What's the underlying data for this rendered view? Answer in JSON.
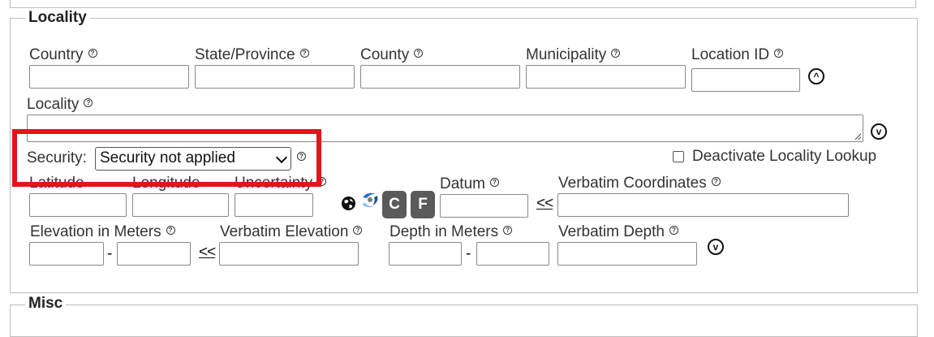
{
  "sections": {
    "locality_legend": "Locality",
    "misc_legend": "Misc"
  },
  "row1": {
    "country_label": "Country",
    "state_label": "State/Province",
    "county_label": "County",
    "municipality_label": "Municipality",
    "location_id_label": "Location ID"
  },
  "locality_label": "Locality",
  "security": {
    "label": "Security:",
    "selected": "Security not applied"
  },
  "deactivate_label": "Deactivate Locality Lookup",
  "row3": {
    "latitude_label": "Latitude",
    "longitude_label": "Longitude",
    "uncertainty_label": "Uncertainty",
    "datum_label": "Datum",
    "verbatim_coords_label": "Verbatim Coordinates",
    "c_button": "C",
    "f_button": "F",
    "copy_arrow": "<<"
  },
  "row4": {
    "elevation_label": "Elevation in Meters",
    "verbatim_elevation_label": "Verbatim Elevation",
    "depth_label": "Depth in Meters",
    "verbatim_depth_label": "Verbatim Depth",
    "dash": "-",
    "copy_arrow": "<<"
  },
  "icons": {
    "help": "?",
    "collapse": "^",
    "expand": "v"
  },
  "colors": {
    "highlight": "#e3141b",
    "button_dark": "#5a5a5a"
  }
}
